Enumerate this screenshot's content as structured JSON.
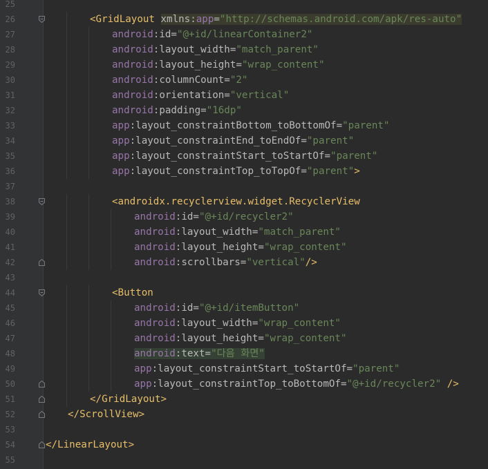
{
  "editor": {
    "language": "xml",
    "colors": {
      "background": "#2b2b2b",
      "gutter": "#313335",
      "line_number": "#606366",
      "tag": "#e8bf6a",
      "namespace": "#9876aa",
      "attribute": "#bababa",
      "value": "#6a8759"
    },
    "lines": [
      {
        "n": "25",
        "indent": 0,
        "tokens": []
      },
      {
        "n": "26",
        "indent": 2,
        "fold": "open",
        "tokens": [
          {
            "t": "tag",
            "s": "<GridLayout "
          },
          {
            "t": "attr",
            "s": "xmlns:",
            "hl": true
          },
          {
            "t": "ns",
            "s": "app",
            "hl": true
          },
          {
            "t": "punct",
            "s": "=",
            "hl": true
          },
          {
            "t": "val",
            "s": "\"http://schemas.android.com/apk/res-auto\"",
            "hl": true
          }
        ]
      },
      {
        "n": "27",
        "indent": 3,
        "tokens": [
          {
            "t": "ns",
            "s": "android"
          },
          {
            "t": "attr",
            "s": ":id"
          },
          {
            "t": "punct",
            "s": "="
          },
          {
            "t": "val",
            "s": "\"@+id/linearContainer2\""
          }
        ]
      },
      {
        "n": "28",
        "indent": 3,
        "tokens": [
          {
            "t": "ns",
            "s": "android"
          },
          {
            "t": "attr",
            "s": ":layout_width"
          },
          {
            "t": "punct",
            "s": "="
          },
          {
            "t": "val",
            "s": "\"match_parent\""
          }
        ]
      },
      {
        "n": "29",
        "indent": 3,
        "tokens": [
          {
            "t": "ns",
            "s": "android"
          },
          {
            "t": "attr",
            "s": ":layout_height"
          },
          {
            "t": "punct",
            "s": "="
          },
          {
            "t": "val",
            "s": "\"wrap_content\""
          }
        ]
      },
      {
        "n": "30",
        "indent": 3,
        "tokens": [
          {
            "t": "ns",
            "s": "android"
          },
          {
            "t": "attr",
            "s": ":columnCount"
          },
          {
            "t": "punct",
            "s": "="
          },
          {
            "t": "val",
            "s": "\"2\""
          }
        ]
      },
      {
        "n": "31",
        "indent": 3,
        "tokens": [
          {
            "t": "ns",
            "s": "android"
          },
          {
            "t": "attr",
            "s": ":orientation"
          },
          {
            "t": "punct",
            "s": "="
          },
          {
            "t": "val",
            "s": "\"vertical\""
          }
        ]
      },
      {
        "n": "32",
        "indent": 3,
        "tokens": [
          {
            "t": "ns",
            "s": "android"
          },
          {
            "t": "attr",
            "s": ":padding"
          },
          {
            "t": "punct",
            "s": "="
          },
          {
            "t": "val",
            "s": "\"16dp\""
          }
        ]
      },
      {
        "n": "33",
        "indent": 3,
        "tokens": [
          {
            "t": "ns",
            "s": "app"
          },
          {
            "t": "attr",
            "s": ":layout_constraintBottom_toBottomOf"
          },
          {
            "t": "punct",
            "s": "="
          },
          {
            "t": "val",
            "s": "\"parent\""
          }
        ]
      },
      {
        "n": "34",
        "indent": 3,
        "tokens": [
          {
            "t": "ns",
            "s": "app"
          },
          {
            "t": "attr",
            "s": ":layout_constraintEnd_toEndOf"
          },
          {
            "t": "punct",
            "s": "="
          },
          {
            "t": "val",
            "s": "\"parent\""
          }
        ]
      },
      {
        "n": "35",
        "indent": 3,
        "tokens": [
          {
            "t": "ns",
            "s": "app"
          },
          {
            "t": "attr",
            "s": ":layout_constraintStart_toStartOf"
          },
          {
            "t": "punct",
            "s": "="
          },
          {
            "t": "val",
            "s": "\"parent\""
          }
        ]
      },
      {
        "n": "36",
        "indent": 3,
        "tokens": [
          {
            "t": "ns",
            "s": "app"
          },
          {
            "t": "attr",
            "s": ":layout_constraintTop_toTopOf"
          },
          {
            "t": "punct",
            "s": "="
          },
          {
            "t": "val",
            "s": "\"parent\""
          },
          {
            "t": "tag",
            "s": ">"
          }
        ]
      },
      {
        "n": "37",
        "indent": 0,
        "tokens": []
      },
      {
        "n": "38",
        "indent": 3,
        "fold": "open",
        "tokens": [
          {
            "t": "tag",
            "s": "<androidx.recyclerview.widget.RecyclerView"
          }
        ]
      },
      {
        "n": "39",
        "indent": 4,
        "tokens": [
          {
            "t": "ns",
            "s": "android"
          },
          {
            "t": "attr",
            "s": ":id"
          },
          {
            "t": "punct",
            "s": "="
          },
          {
            "t": "val",
            "s": "\"@+id/recycler2\""
          }
        ]
      },
      {
        "n": "40",
        "indent": 4,
        "tokens": [
          {
            "t": "ns",
            "s": "android"
          },
          {
            "t": "attr",
            "s": ":layout_width"
          },
          {
            "t": "punct",
            "s": "="
          },
          {
            "t": "val",
            "s": "\"match_parent\""
          }
        ]
      },
      {
        "n": "41",
        "indent": 4,
        "tokens": [
          {
            "t": "ns",
            "s": "android"
          },
          {
            "t": "attr",
            "s": ":layout_height"
          },
          {
            "t": "punct",
            "s": "="
          },
          {
            "t": "val",
            "s": "\"wrap_content\""
          }
        ]
      },
      {
        "n": "42",
        "indent": 4,
        "fold": "close",
        "tokens": [
          {
            "t": "ns",
            "s": "android"
          },
          {
            "t": "attr",
            "s": ":scrollbars"
          },
          {
            "t": "punct",
            "s": "="
          },
          {
            "t": "val",
            "s": "\"vertical\""
          },
          {
            "t": "tag",
            "s": "/>"
          }
        ]
      },
      {
        "n": "43",
        "indent": 0,
        "tokens": []
      },
      {
        "n": "44",
        "indent": 3,
        "fold": "open",
        "tokens": [
          {
            "t": "tag",
            "s": "<Button"
          }
        ]
      },
      {
        "n": "45",
        "indent": 4,
        "tokens": [
          {
            "t": "ns",
            "s": "android"
          },
          {
            "t": "attr",
            "s": ":id"
          },
          {
            "t": "punct",
            "s": "="
          },
          {
            "t": "val",
            "s": "\"@+id/itemButton\""
          }
        ]
      },
      {
        "n": "46",
        "indent": 4,
        "tokens": [
          {
            "t": "ns",
            "s": "android"
          },
          {
            "t": "attr",
            "s": ":layout_width"
          },
          {
            "t": "punct",
            "s": "="
          },
          {
            "t": "val",
            "s": "\"wrap_content\""
          }
        ]
      },
      {
        "n": "47",
        "indent": 4,
        "tokens": [
          {
            "t": "ns",
            "s": "android"
          },
          {
            "t": "attr",
            "s": ":layout_height"
          },
          {
            "t": "punct",
            "s": "="
          },
          {
            "t": "val",
            "s": "\"wrap_content\""
          }
        ]
      },
      {
        "n": "48",
        "indent": 4,
        "tokens": [
          {
            "t": "ns",
            "s": "android",
            "hl2": true
          },
          {
            "t": "attr",
            "s": ":text",
            "hl2": true
          },
          {
            "t": "punct",
            "s": "=",
            "hl2": true
          },
          {
            "t": "val",
            "s": "\"다음 화면\"",
            "hl2": true
          }
        ]
      },
      {
        "n": "49",
        "indent": 4,
        "tokens": [
          {
            "t": "ns",
            "s": "app"
          },
          {
            "t": "attr",
            "s": ":layout_constraintStart_toStartOf"
          },
          {
            "t": "punct",
            "s": "="
          },
          {
            "t": "val",
            "s": "\"parent\""
          }
        ]
      },
      {
        "n": "50",
        "indent": 4,
        "fold": "close",
        "tokens": [
          {
            "t": "ns",
            "s": "app"
          },
          {
            "t": "attr",
            "s": ":layout_constraintTop_toBottomOf"
          },
          {
            "t": "punct",
            "s": "="
          },
          {
            "t": "val",
            "s": "\"@+id/recycler2\""
          },
          {
            "t": "tag",
            "s": " />"
          }
        ]
      },
      {
        "n": "51",
        "indent": 2,
        "fold": "close",
        "tokens": [
          {
            "t": "tag",
            "s": "</GridLayout>"
          }
        ]
      },
      {
        "n": "52",
        "indent": 1,
        "fold": "close",
        "tokens": [
          {
            "t": "tag",
            "s": "</ScrollView>"
          }
        ]
      },
      {
        "n": "53",
        "indent": 0,
        "tokens": []
      },
      {
        "n": "54",
        "indent": 0,
        "fold": "close",
        "tokens": [
          {
            "t": "tag",
            "s": "</LinearLayout>"
          }
        ]
      },
      {
        "n": "55",
        "indent": 0,
        "tokens": []
      }
    ]
  }
}
